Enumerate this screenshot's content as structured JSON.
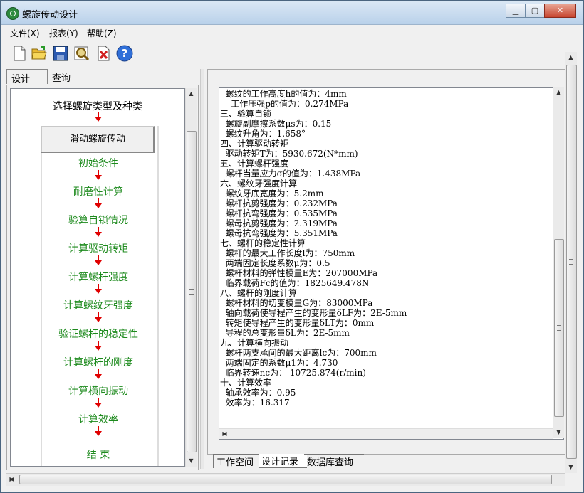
{
  "window": {
    "title": "螺旋传动设计",
    "minimize": "▁",
    "maximize": "▢",
    "close": "✕"
  },
  "menu": [
    "文件(X)",
    "报表(Y)",
    "帮助(Z)"
  ],
  "toolbar": [
    "new-icon",
    "open-icon",
    "save-icon",
    "preview-icon",
    "delete-icon",
    "help-icon"
  ],
  "left_tabs": [
    "设计",
    "查询"
  ],
  "flow": {
    "title": "选择螺旋类型及种类",
    "first": "滑动螺旋传动",
    "steps": [
      "初始条件",
      "耐磨性计算",
      "验算自锁情况",
      "计算驱动转矩",
      "计算螺杆强度",
      "计算螺纹牙强度",
      "验证螺杆的稳定性",
      "计算螺杆的刚度",
      "计算横向振动",
      "计算效率",
      "结 束"
    ]
  },
  "report_lines": [
    "  螺纹的工作高度h的值为：4mm",
    "    工作压强p的值为：0.274MPa",
    "三、验算自锁",
    "  螺旋副摩擦系数μs为：0.15",
    "  螺纹升角为：1.658°",
    "四、计算驱动转矩",
    "  驱动转矩T为：5930.672(N*mm)",
    "五、计算螺杆强度",
    "  螺杆当量应力σ的值为：1.438MPa",
    "六、螺纹牙强度计算",
    "  螺纹牙底宽度为：5.2mm",
    "  螺杆抗剪强度为：0.232MPa",
    "  螺杆抗弯强度为：0.535MPa",
    "  螺母抗剪强度为：2.319MPa",
    "  螺母抗弯强度为：5.351MPa",
    "七、螺杆的稳定性计算",
    "  螺杆的最大工作长度l为：750mm",
    "  两端固定长度系数μ为：0.5",
    "  螺杆材料的弹性模量E为：207000MPa",
    "  临界载荷Fc的值为：1825649.478N",
    "八、螺杆的刚度计算",
    "  螺杆材料的切变模量G为：83000MPa",
    "  轴向载荷使导程产生的变形量δLF为：2E-5mm",
    "  转矩使导程产生的变形量δLT为：0mm",
    "  导程的总变形量δL为：2E-5mm",
    "九、计算横向振动",
    "  螺杆两支承间的最大距离lc为：700mm",
    "  两端固定的系数μ1为：4.730",
    "  临界转速nc为： 10725.874(r/min)",
    "十、计算效率",
    "  轴承效率为：0.95",
    "  效率为：16.317"
  ],
  "bottom_tabs": [
    "工作空间",
    "设计记录",
    "数据库查询"
  ]
}
